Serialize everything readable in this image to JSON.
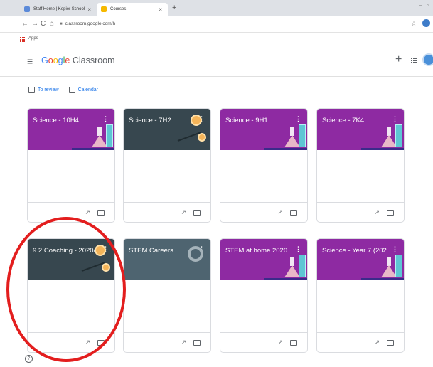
{
  "browser": {
    "tabs": [
      {
        "label": "Staff Home | Kepier School",
        "color": "#5b8ad9"
      },
      {
        "label": "Courses",
        "color": "#f6b900"
      }
    ],
    "url": "classroom.google.com/h",
    "bookmarks_label": "Apps"
  },
  "header": {
    "logo_google": [
      "G",
      "o",
      "o",
      "g",
      "l",
      "e"
    ],
    "logo_product": "Classroom"
  },
  "links": {
    "to_review": "To review",
    "calendar": "Calendar"
  },
  "courses": [
    {
      "title": "Science - 10H4",
      "theme": "purple"
    },
    {
      "title": "Science - 7H2",
      "theme": "dark"
    },
    {
      "title": "Science - 9H1",
      "theme": "purple"
    },
    {
      "title": "Science - 7K4",
      "theme": "purple"
    },
    {
      "title": "9.2 Coaching - 2020/...",
      "theme": "dark"
    },
    {
      "title": "STEM Careers",
      "theme": "slate"
    },
    {
      "title": "STEM at home 2020",
      "theme": "purple"
    },
    {
      "title": "Science - Year 7 (202...",
      "theme": "purple"
    }
  ],
  "colors": {
    "purple_banner": "#8e2aa2",
    "dark_banner": "#37474f",
    "slate_banner": "#4e6470",
    "annotation": "#e31e1e",
    "link": "#1a73e8"
  },
  "icons": {
    "kebab": "⋮",
    "trend": "↗",
    "plus": "+",
    "menu": "≡"
  }
}
